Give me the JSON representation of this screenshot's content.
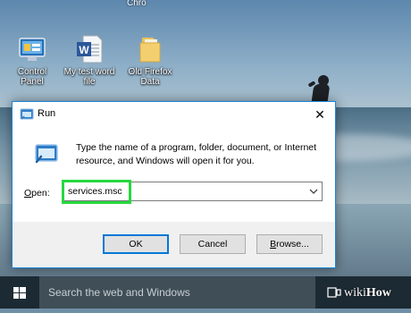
{
  "desktop": {
    "top_partial_label": "Chro",
    "icons": [
      {
        "label_line1": "Control",
        "label_line2": "Panel",
        "icon": "control-panel-icon"
      },
      {
        "label_line1": "My test word",
        "label_line2": "file",
        "icon": "word-document-icon"
      },
      {
        "label_line1": "Old Firefox",
        "label_line2": "Data",
        "icon": "folder-icon"
      }
    ]
  },
  "run_dialog": {
    "title": "Run",
    "close_glyph": "✕",
    "description": "Type the name of a program, folder, document, or Internet resource, and Windows will open it for you.",
    "open_label_u": "O",
    "open_label_rest": "pen:",
    "open_value": "services.msc",
    "buttons": {
      "ok": "OK",
      "cancel": "Cancel",
      "browse_u": "B",
      "browse_rest": "rowse..."
    },
    "highlight_color": "#27d83f"
  },
  "taskbar": {
    "search_placeholder": "Search the web and Windows",
    "watermark_wiki": "wiki",
    "watermark_how": "How"
  },
  "colors": {
    "accent": "#0078d7",
    "taskbar": "#1c2a33",
    "search_box": "#3f4e57"
  }
}
